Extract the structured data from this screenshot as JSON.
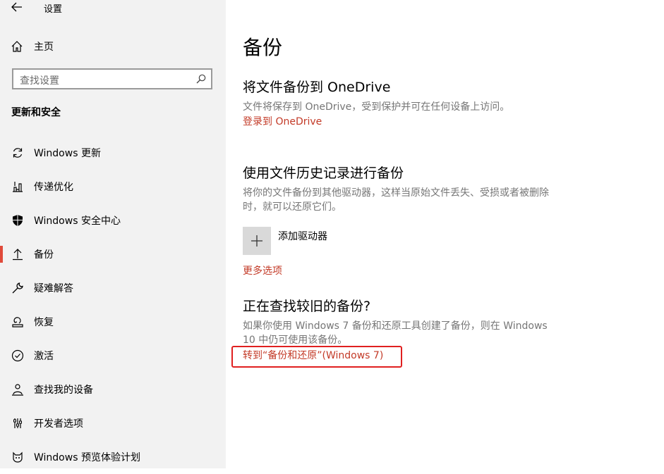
{
  "window": {
    "title": "设置"
  },
  "sidebar": {
    "home_label": "主页",
    "search_placeholder": "查找设置",
    "section_title": "更新和安全",
    "items": [
      {
        "label": "Windows 更新",
        "icon": "sync-icon"
      },
      {
        "label": "传递优化",
        "icon": "delivery-optimization-icon"
      },
      {
        "label": "Windows 安全中心",
        "icon": "shield-icon"
      },
      {
        "label": "备份",
        "icon": "backup-arrow-icon",
        "active": true
      },
      {
        "label": "疑难解答",
        "icon": "wrench-icon"
      },
      {
        "label": "恢复",
        "icon": "recovery-icon"
      },
      {
        "label": "激活",
        "icon": "check-circle-icon"
      },
      {
        "label": "查找我的设备",
        "icon": "person-pin-icon"
      },
      {
        "label": "开发者选项",
        "icon": "developer-tools-icon"
      },
      {
        "label": "Windows 预览体验计划",
        "icon": "insider-cat-icon"
      }
    ]
  },
  "main": {
    "page_title": "备份",
    "onedrive": {
      "heading": "将文件备份到 OneDrive",
      "description": "文件将保存到 OneDrive，受到保护并可在任何设备上访问。",
      "link": "登录到 OneDrive"
    },
    "file_history": {
      "heading": "使用文件历史记录进行备份",
      "description": "将你的文件备份到其他驱动器，这样当原始文件丢失、受损或者被删除时，就可以还原它们。",
      "add_drive_label": "添加驱动器",
      "more_options": "更多选项"
    },
    "older_backup": {
      "heading": "正在查找较旧的备份?",
      "description": "如果你使用 Windows 7 备份和还原工具创建了备份，则在 Windows 10 中仍可使用该备份。",
      "link": "转到“备份和还原”(Windows 7)"
    }
  },
  "colors": {
    "accent": "#c33a27",
    "highlight_box": "#e02020",
    "active_indicator": "#e04a3a",
    "sidebar_bg": "#f2f2f2"
  }
}
